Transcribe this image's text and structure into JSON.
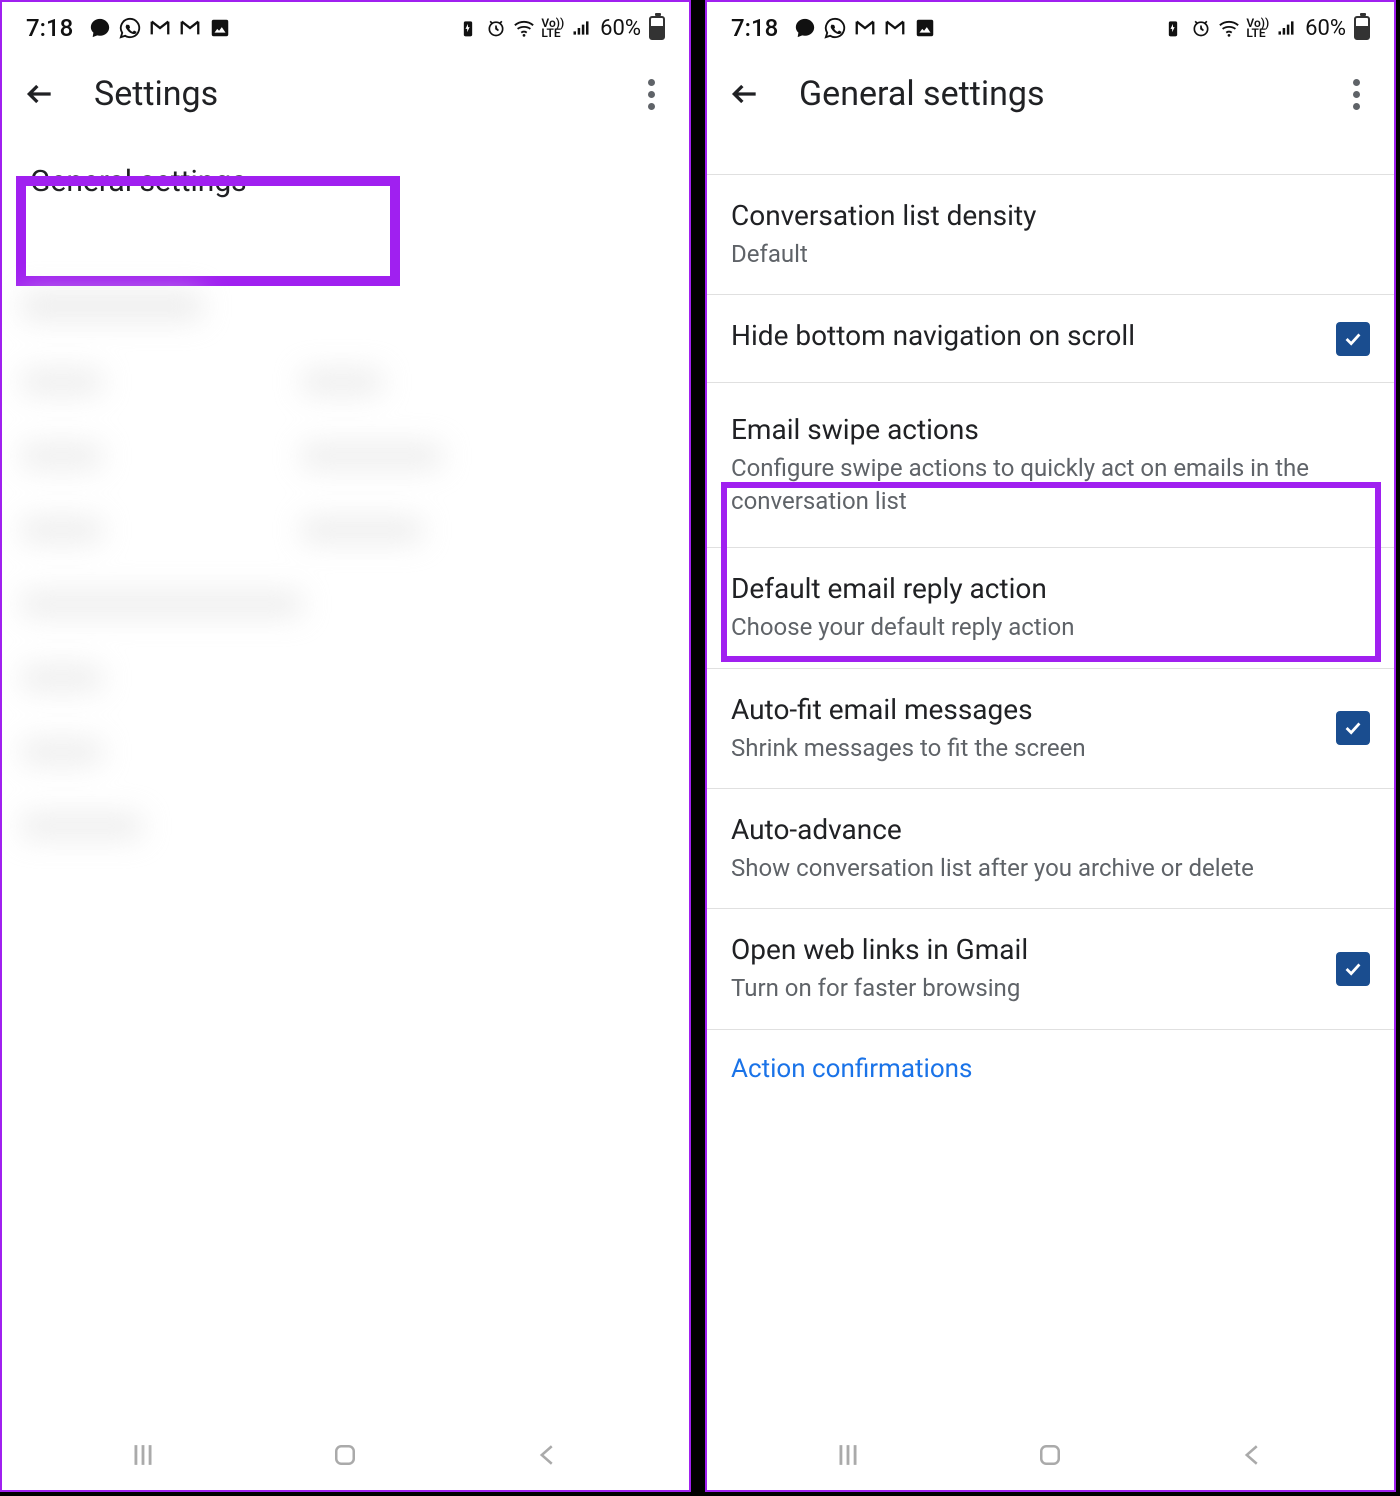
{
  "status": {
    "time": "7:18",
    "battery_pct": "60%"
  },
  "left_screen": {
    "title": "Settings",
    "first_item": "General settings"
  },
  "right_screen": {
    "title": "General settings",
    "items": [
      {
        "title": "Conversation list density",
        "sub": "Default",
        "check": null
      },
      {
        "title": "Hide bottom navigation on scroll",
        "sub": "",
        "check": true
      },
      {
        "title": "Email swipe actions",
        "sub": "Configure swipe actions to quickly act on emails in the conversation list",
        "check": null
      },
      {
        "title": "Default email reply action",
        "sub": "Choose your default reply action",
        "check": null
      },
      {
        "title": "Auto-fit email messages",
        "sub": "Shrink messages to fit the screen",
        "check": true
      },
      {
        "title": "Auto-advance",
        "sub": "Show conversation list after you archive or delete",
        "check": null
      },
      {
        "title": "Open web links in Gmail",
        "sub": "Turn on for faster browsing",
        "check": true
      }
    ],
    "section_label": "Action confirmations"
  }
}
